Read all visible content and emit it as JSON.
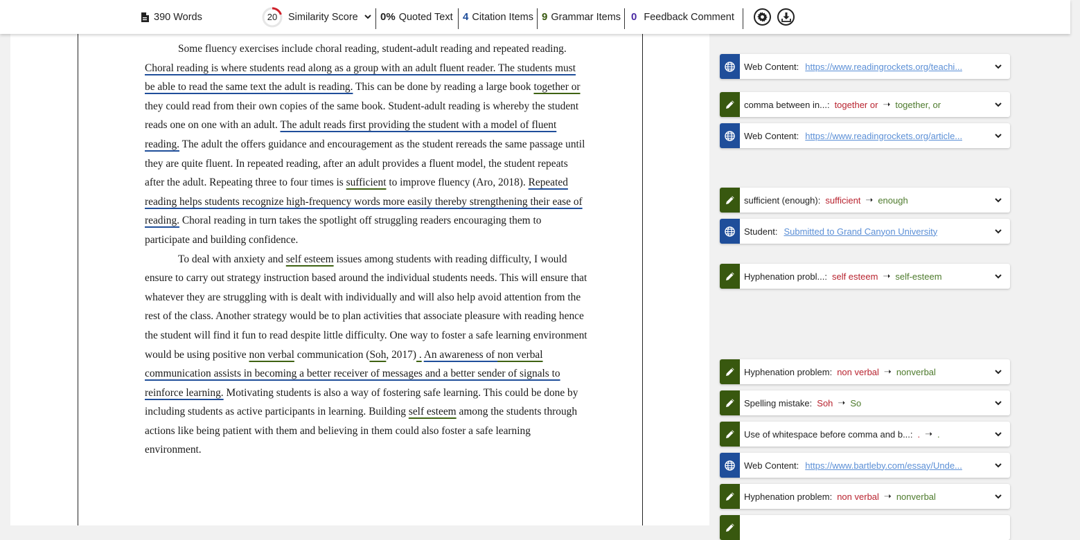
{
  "toolbar": {
    "words": "390 Words",
    "similarity_score": "20",
    "similarity_label": "Similarity Score",
    "quoted_value": "0%",
    "quoted_label": "Quoted Text",
    "citation_value": "4",
    "citation_label": "Citation Items",
    "grammar_value": "9",
    "grammar_label": "Grammar Items",
    "feedback_value": "0",
    "feedback_label": "Feedback Comment",
    "colors": {
      "similarity": "#d0202a",
      "citation": "#1f4e9a",
      "grammar": "#38580f",
      "feedback": "#4a2aa3"
    }
  },
  "document": {
    "p1": {
      "s1": "Some fluency exercises include choral reading, student-adult reading and repeated reading. ",
      "h1": "Choral reading is where students read along as a group with an adult fluent reader.  The students must be able to read the same text the adult is reading.",
      "s2": " This can be done by reading a large book ",
      "g1": "together or",
      "s3": " they could read from their own copies of the same book. Student-adult reading is whereby the student reads one on one with an adult. ",
      "h2": "The adult reads first providing the student with a model of fluent reading.",
      "s4": " The adult the offers guidance and encouragement as the student rereads the same passage until they are quite fluent. In repeated reading, after an adult provides a fluent model, the student repeats after the adult. Repeating three to four times is ",
      "g2": "sufficient",
      "s5": " to improve fluency (Aro, 2018). ",
      "h3": "Repeated reading helps students recognize high-frequency words more easily thereby strengthening their ease of reading.",
      "s6": " Choral reading in turn takes the spotlight off struggling readers encouraging them to participate and building confidence."
    },
    "p2": {
      "s1": "To deal with anxiety and ",
      "g1": "self esteem",
      "s2": " issues among students with reading difficulty, I would ensure to carry out strategy instruction based around the individual students needs. This will ensure that whatever they are struggling with is dealt with individually and will also help avoid attention from the rest of the class. Another strategy would be to plan activities that associate pleasure with reading hence the student will find it fun to read despite little difficulty. One way to foster a safe learning environment would be using positive ",
      "g2": "non verbal",
      "s3": " communication (",
      "g3": "Soh",
      "s4": ", 2017)",
      "g4": " .",
      "s5": " ",
      "h1a": "An awareness of ",
      "g5": "non verbal",
      "h1b": " communication assists in becoming a better receiver of messages and a better sender of signals to reinforce learning.",
      "s6": " Motivating students is also a way of fostering safe learning. This could be done by including students as active participants in learning. Building ",
      "g6": "self esteem",
      "s7": " among the students through actions like being patient with them and believing in them could also foster a safe learning environment."
    }
  },
  "feedback_cards": [
    {
      "kind": "web",
      "icon": "globe-icon",
      "label": "Web Content:",
      "link": "https://www.readingrockets.org/teachi..."
    },
    {
      "kind": "grammar",
      "icon": "pencil-icon",
      "label": "comma between in...:",
      "wrong": "together or",
      "right": "together, or"
    },
    {
      "kind": "web",
      "icon": "globe-icon",
      "label": "Web Content:",
      "link": "https://www.readingrockets.org/article..."
    },
    {
      "kind": "grammar",
      "icon": "pencil-icon",
      "label": "sufficient (enough):",
      "wrong": "sufficient",
      "right": "enough"
    },
    {
      "kind": "web",
      "icon": "globe-icon",
      "label": "Student:",
      "link": "Submitted to Grand Canyon University"
    },
    {
      "kind": "grammar",
      "icon": "pencil-icon",
      "label": "Hyphenation probl...:",
      "wrong": "self esteem",
      "right": "self-esteem"
    },
    {
      "kind": "grammar",
      "icon": "pencil-icon",
      "label": "Hyphenation problem:",
      "wrong": "non verbal",
      "right": "nonverbal"
    },
    {
      "kind": "grammar",
      "icon": "pencil-icon",
      "label": "Spelling mistake:",
      "wrong": "Soh",
      "right": "So"
    },
    {
      "kind": "grammar",
      "icon": "pencil-icon",
      "label": "Use of whitespace before comma and b...:",
      "wrong": " .",
      "right": "."
    },
    {
      "kind": "web",
      "icon": "globe-icon",
      "label": "Web Content:",
      "link": "https://www.bartleby.com/essay/Unde..."
    },
    {
      "kind": "grammar",
      "icon": "pencil-icon",
      "label": "Hyphenation problem:",
      "wrong": "non verbal",
      "right": "nonverbal"
    }
  ]
}
